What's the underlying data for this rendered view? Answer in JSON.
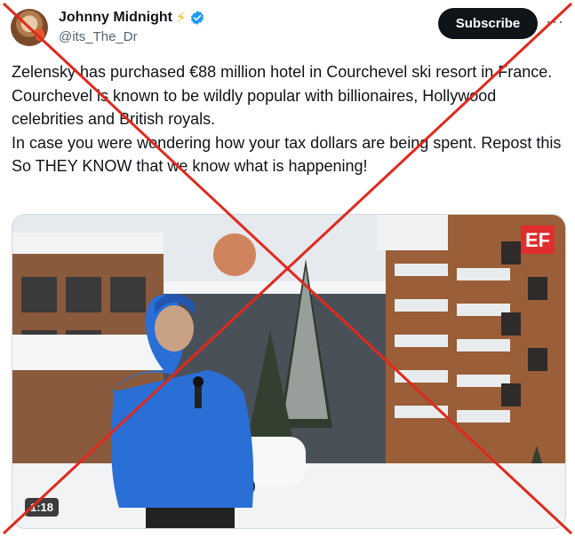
{
  "author": {
    "name": "Johnny Midnight",
    "handle": "@its_The_Dr",
    "badge_icon": "bolt-icon",
    "verified_icon": "verified-badge-icon"
  },
  "actions": {
    "subscribe_label": "Subscribe",
    "more_icon": "more-dots-icon"
  },
  "tweet": {
    "lines": [
      "Zelensky has purchased €88 million hotel in Courchevel ski resort in France.",
      "Courchevel is known to be wildly popular with billionaires, Hollywood celebrities and British royals.",
      "In case you were wondering how your tax dollars are being spent. Repost this So THEY KNOW that we know what is happening!"
    ]
  },
  "media": {
    "watermark": "EF",
    "duration": "1:18"
  },
  "colors": {
    "cross": "#e0291d",
    "subscribe_bg": "#0f1419",
    "verified": "#1d9bf0",
    "jacket": "#2a6fd6"
  }
}
